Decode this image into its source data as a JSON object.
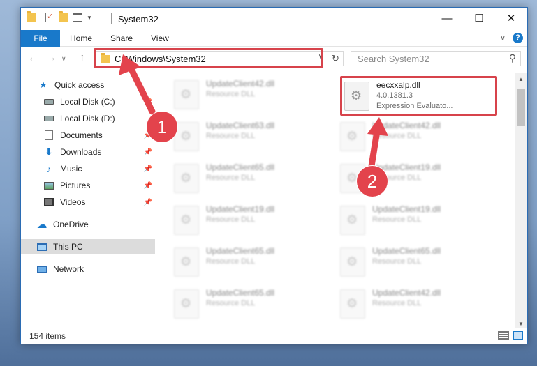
{
  "window": {
    "title": "System32",
    "controls": {
      "minimize": "—",
      "maximize": "☐",
      "close": "✕"
    }
  },
  "ribbon": {
    "tabs": [
      {
        "label": "File"
      },
      {
        "label": "Home"
      },
      {
        "label": "Share"
      },
      {
        "label": "View"
      }
    ],
    "help": "?"
  },
  "navigation": {
    "address": "C:\\Windows\\System32",
    "search_placeholder": "Search System32"
  },
  "sidebar": {
    "items": [
      {
        "label": "Quick access",
        "icon": "star-icon",
        "pinned": false
      },
      {
        "label": "Local Disk (C:)",
        "icon": "drive-icon",
        "pinned": false
      },
      {
        "label": "Local Disk (D:)",
        "icon": "drive-icon",
        "pinned": false
      },
      {
        "label": "Documents",
        "icon": "documents-icon",
        "pinned": true
      },
      {
        "label": "Downloads",
        "icon": "download-icon",
        "pinned": true
      },
      {
        "label": "Music",
        "icon": "music-icon",
        "pinned": true
      },
      {
        "label": "Pictures",
        "icon": "pictures-icon",
        "pinned": true
      },
      {
        "label": "Videos",
        "icon": "videos-icon",
        "pinned": true
      },
      {
        "label": "OneDrive",
        "icon": "onedrive-icon",
        "pinned": false
      },
      {
        "label": "This PC",
        "icon": "computer-icon",
        "pinned": false,
        "selected": true
      },
      {
        "label": "Network",
        "icon": "network-icon",
        "pinned": false
      }
    ]
  },
  "files": {
    "focused": {
      "name": "eecxxalp.dll",
      "version": "4.0.1381.3",
      "description": "Expression Evaluato..."
    },
    "left_column": [
      {
        "name": "UpdateClient42.dll",
        "type": "Resource DLL"
      },
      {
        "name": "UpdateClient63.dll",
        "type": "Resource DLL"
      },
      {
        "name": "UpdateClient65.dll",
        "type": "Resource DLL"
      },
      {
        "name": "UpdateClient19.dll",
        "type": "Resource DLL"
      },
      {
        "name": "UpdateClient65.dll",
        "type": "Resource DLL"
      },
      {
        "name": "UpdateClient65.dll",
        "type": "Resource DLL"
      }
    ],
    "right_column": [
      {
        "name": "UpdateClient42.dll",
        "type": "Resource DLL"
      },
      {
        "name": "UpdateClient19.dll",
        "type": "Resource DLL"
      },
      {
        "name": "UpdateClient19.dll",
        "type": "Resource DLL"
      },
      {
        "name": "UpdateClient65.dll",
        "type": "Resource DLL"
      },
      {
        "name": "UpdateClient42.dll",
        "type": "Resource DLL"
      }
    ]
  },
  "status": {
    "item_count": "154 items"
  },
  "callouts": [
    "1",
    "2"
  ],
  "colors": {
    "accent": "#1979ca",
    "highlight": "#d7434b"
  }
}
